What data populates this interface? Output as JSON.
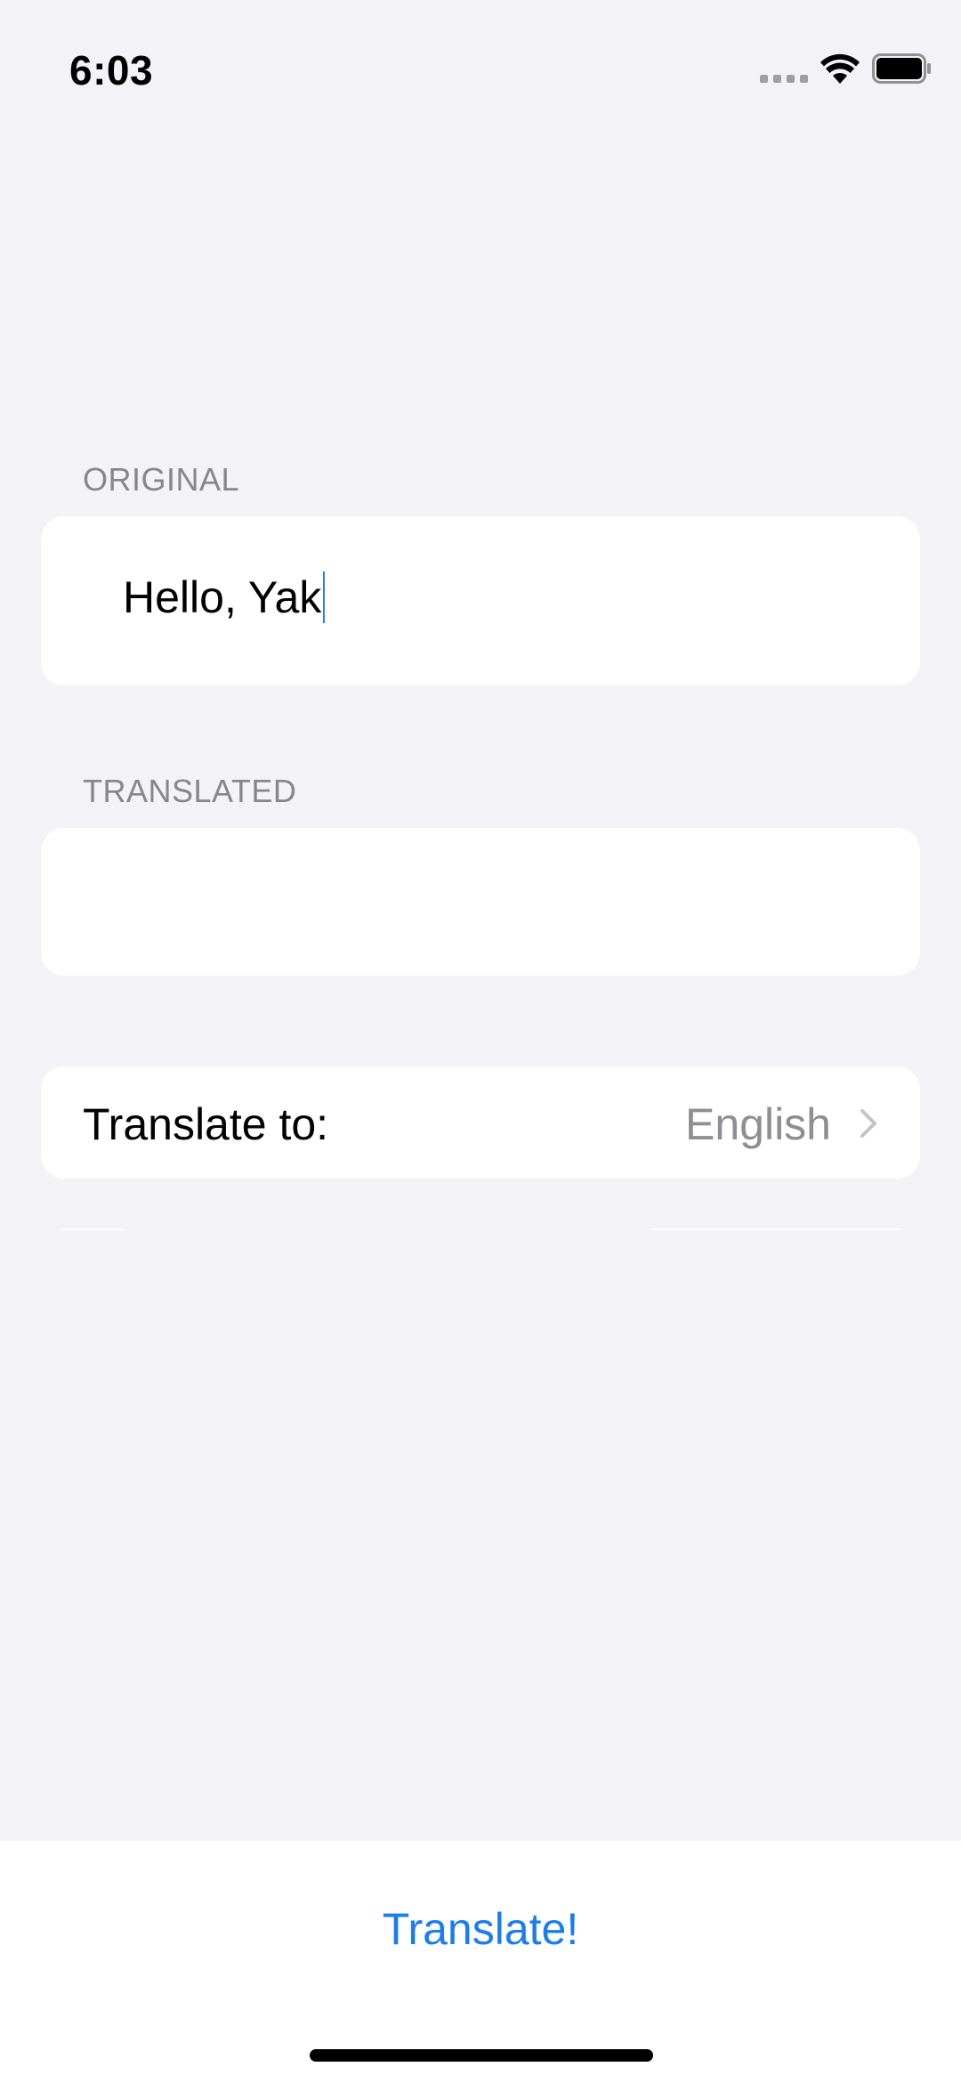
{
  "status_bar": {
    "time": "6:03",
    "icons": [
      "cellular-signal-icon",
      "wifi-icon",
      "battery-icon"
    ]
  },
  "form": {
    "original_header": "ORIGINAL",
    "original_value": "Hello, Yak",
    "translated_header": "TRANSLATED",
    "translated_value": "",
    "translate_to_label": "Translate to:",
    "translate_to_value": "English"
  },
  "toolbar": {
    "translate_label": "Translate!"
  },
  "colors": {
    "background": "#f2f2f7",
    "card": "#ffffff",
    "accent": "#1a7cf0",
    "secondary_text": "#8e8e93",
    "header_text": "#86868b"
  }
}
